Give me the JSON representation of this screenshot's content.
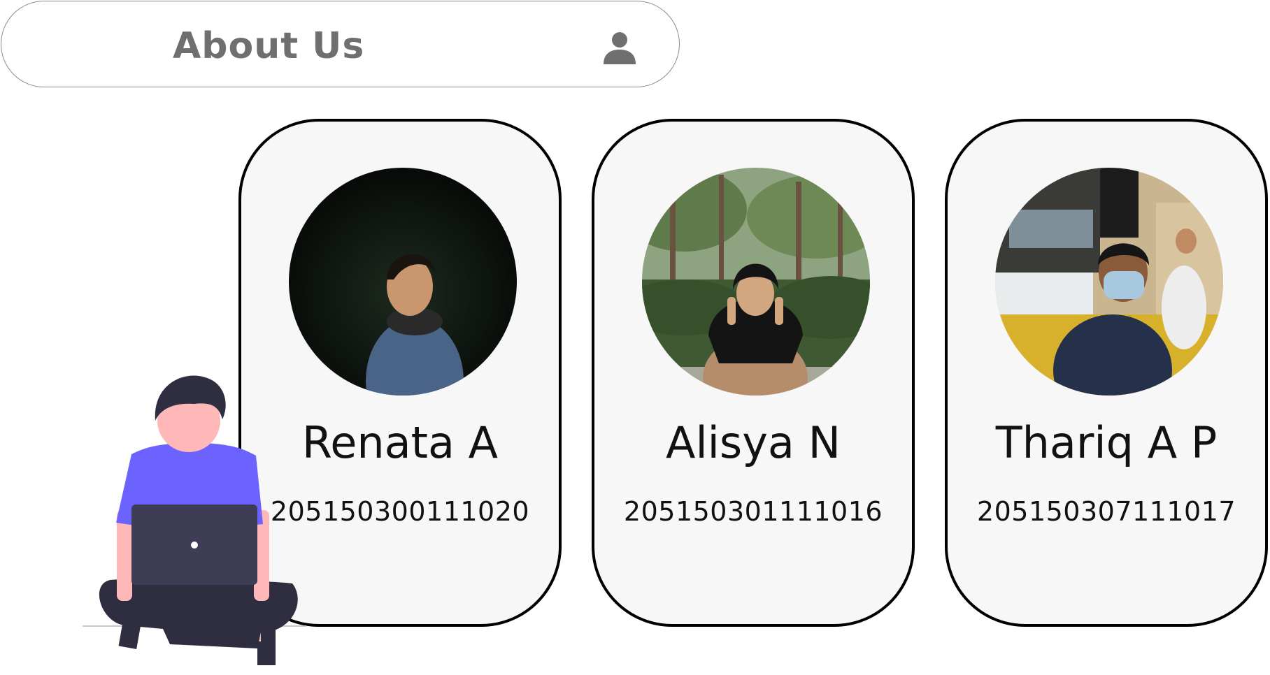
{
  "header": {
    "title": "About Us",
    "profile_icon": "user-icon"
  },
  "members": [
    {
      "name": "Renata A",
      "id": "205150300111020",
      "photo": "photo-renata"
    },
    {
      "name": "Alisya N",
      "id": "205150301111016",
      "photo": "photo-alisya"
    },
    {
      "name": "Thariq A P",
      "id": "205150307111017",
      "photo": "photo-thariq"
    }
  ],
  "illustration": {
    "name": "person-with-laptop",
    "colors": {
      "shirt": "#6c63ff",
      "skin": "#ffb8b8",
      "hair": "#2f2e41",
      "laptop": "#3f3d56"
    }
  },
  "colors": {
    "header_text": "#6f6f6f",
    "card_bg": "#f7f7f7",
    "card_border": "#000000",
    "text": "#111111"
  }
}
